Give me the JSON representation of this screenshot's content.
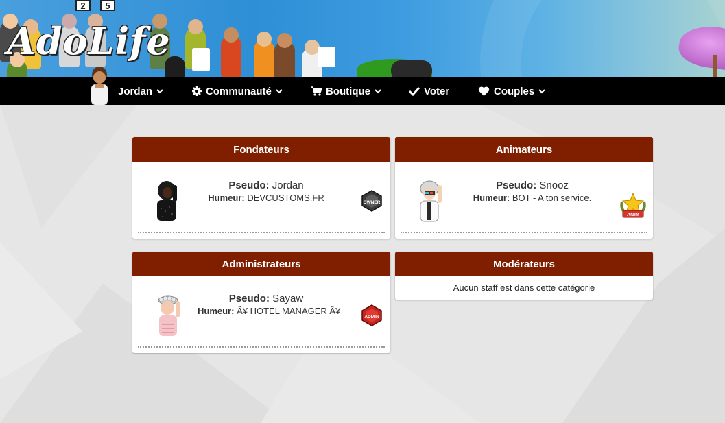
{
  "header": {
    "logo_text": "AdoLife",
    "scoreboard": [
      "2",
      "5"
    ]
  },
  "nav": {
    "items": [
      {
        "label": "Jordan",
        "icon": "avatar",
        "dropdown": true
      },
      {
        "label": "Communauté",
        "icon": "gear-icon",
        "dropdown": true
      },
      {
        "label": "Boutique",
        "icon": "cart-icon",
        "dropdown": true
      },
      {
        "label": "Voter",
        "icon": "check-icon",
        "dropdown": false
      },
      {
        "label": "Couples",
        "icon": "heart-icon",
        "dropdown": true
      }
    ]
  },
  "colors": {
    "card_header": "#7f1f00",
    "navbar": "#000000",
    "page_bg": "#e6e6e6"
  },
  "groups": [
    {
      "title": "Fondateurs",
      "pseudo_label": "Pseudo:",
      "pseudo": "Jordan",
      "mood_label": "Humeur:",
      "mood": "DEVCUSTOMS.FR",
      "badge_text": "OWNER"
    },
    {
      "title": "Animateurs",
      "pseudo_label": "Pseudo:",
      "pseudo": "Snooz",
      "mood_label": "Humeur:",
      "mood": "BOT - A ton service.",
      "badge_text": "ANIM"
    },
    {
      "title": "Administrateurs",
      "pseudo_label": "Pseudo:",
      "pseudo": "Sayaw",
      "mood_label": "Humeur:",
      "mood": "Â¥ HOTEL MANAGER Â¥",
      "badge_text": "ADMIN"
    },
    {
      "title": "Modérateurs",
      "empty_message": "Aucun staff est dans cette catégorie"
    }
  ]
}
